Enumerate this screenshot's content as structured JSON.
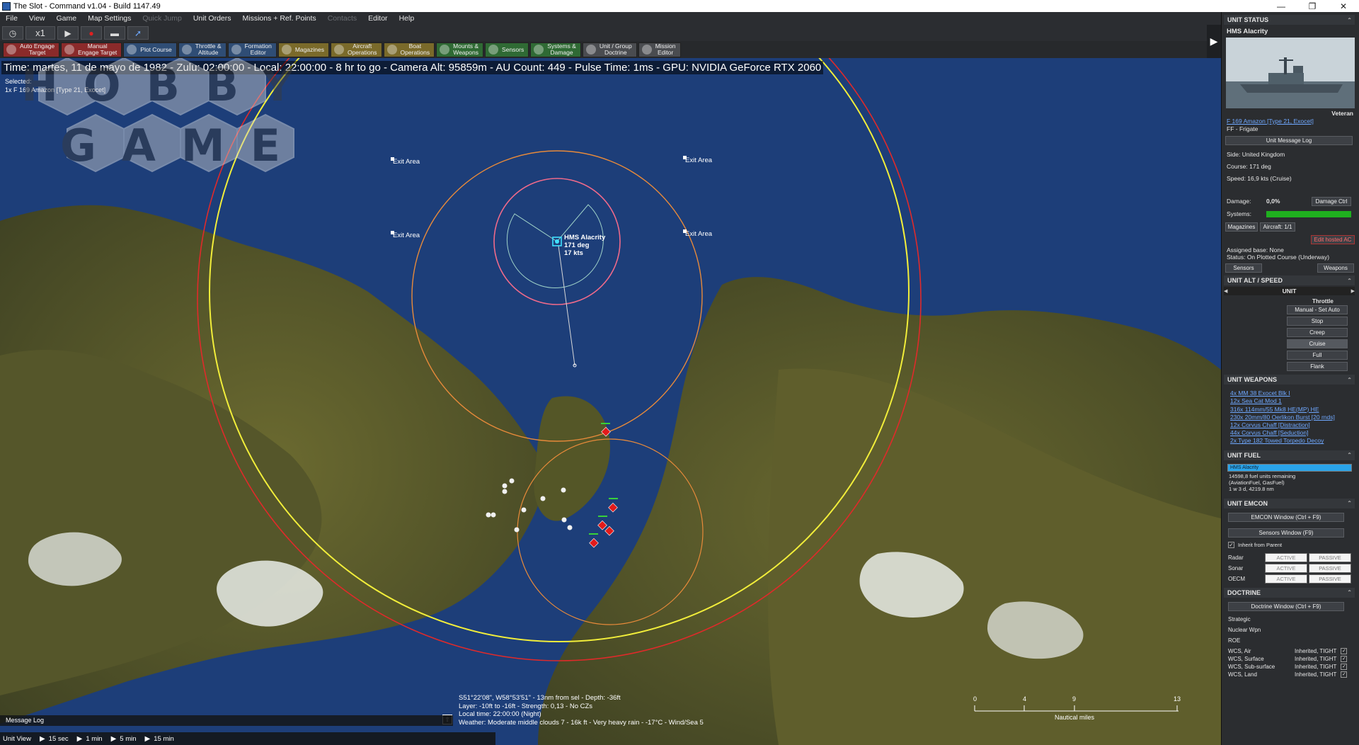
{
  "window": {
    "title": "The Slot - Command v1.04 - Build 1147.49",
    "controls": [
      "—",
      "❐",
      "✕"
    ]
  },
  "menu": [
    "File",
    "View",
    "Game",
    "Map Settings",
    "Quick Jump",
    "Unit Orders",
    "Missions + Ref. Points",
    "Contacts",
    "Editor",
    "Help"
  ],
  "menu_dim": [
    "Quick Jump",
    "Contacts"
  ],
  "playback": {
    "compression": "x1"
  },
  "commands": [
    {
      "l1": "Auto Engage",
      "l2": "Target",
      "color": "red"
    },
    {
      "l1": "Manual",
      "l2": "Engage Target",
      "color": "red"
    },
    {
      "l1": "Plot Course",
      "l2": "",
      "color": "blue"
    },
    {
      "l1": "Throttle &",
      "l2": "Altitude",
      "color": "blue"
    },
    {
      "l1": "Formation",
      "l2": "Editor",
      "color": "blue"
    },
    {
      "l1": "Magazines",
      "l2": "",
      "color": "gold"
    },
    {
      "l1": "Aircraft",
      "l2": "Operations",
      "color": "gold"
    },
    {
      "l1": "Boat",
      "l2": "Operations",
      "color": "gold"
    },
    {
      "l1": "Mounts &",
      "l2": "Weapons",
      "color": "green"
    },
    {
      "l1": "Sensors",
      "l2": "",
      "color": "green"
    },
    {
      "l1": "Systems &",
      "l2": "Damage",
      "color": "green"
    },
    {
      "l1": "Unit / Group",
      "l2": "Doctrine",
      "color": "grey"
    },
    {
      "l1": "Mission",
      "l2": "Editor",
      "color": "grey"
    }
  ],
  "map": {
    "status": "Time: martes, 11 de mayo de 1982 - Zulu: 02:00:00 - Local: 22:00:00 - 8 hr to go -  Camera Alt: 95859m  - AU Count: 449 - Pulse Time: 1ms - GPU: NVIDIA GeForce RTX 2060",
    "selected_label": "Selected:",
    "selected_unit": "1x F 169 Amazon [Type 21, Exocet]",
    "exit_area": "Exit Area",
    "unit_name": "HMS Alacrity",
    "unit_course": "171 deg",
    "unit_speed": "17 kts",
    "coords": [
      "S51°22'08\", W58°53'51\" - 13nm from sel - Depth: -36ft",
      "Layer: -10ft to -16ft - Strength: 0,13 - No CZs",
      "Local time: 22:00:00 (Night)",
      "Weather: Moderate middle clouds 7 - 16k ft - Very heavy rain - -17°C - Wind/Sea 5"
    ],
    "message_log": "Message Log",
    "unit_view": "Unit View",
    "time_steps": [
      "15 sec",
      "1 min",
      "5 min",
      "15 min"
    ],
    "scale_ticks": [
      "0",
      "4",
      "9",
      "13"
    ],
    "scale_unit": "Nautical miles",
    "watermark_top": "HOBBY",
    "watermark_bottom": "GAMES",
    "colors": {
      "sea": "#1d3e79",
      "land": "#5a5a2a",
      "red_ring": "#e02a2a",
      "yellow_ring": "#f2ee3a",
      "orange_ring": "#e88a3a",
      "pink_ring": "#f06a8a"
    }
  },
  "panel": {
    "unit_status": "UNIT STATUS",
    "unit_name": "HMS Alacrity",
    "proficiency": "Veteran",
    "class_link": "F 169 Amazon [Type 21, Exocet]",
    "type": "FF - Frigate",
    "message_log_btn": "Unit Message Log",
    "side": "Side: United Kingdom",
    "course": "Course: 171 deg",
    "speed": "Speed: 16,9 kts (Cruise)",
    "damage_label": "Damage:",
    "damage_value": "0,0%",
    "damage_btn": "Damage Ctrl",
    "systems_label": "Systems:",
    "magazines_btn": "Magazines",
    "aircraft_btn": "Aircraft: 1/1",
    "edit_hosted": "Edit hosted AC",
    "assigned_base": "Assigned base: None",
    "status": "Status: On Plotted Course (Underway)",
    "sensors_btn": "Sensors",
    "weapons_btn": "Weapons",
    "alt_speed": "UNIT ALT / SPEED",
    "unit_lbl": "UNIT",
    "throttle": "Throttle",
    "throttle_btns": [
      "Manual - Set Auto",
      "Stop",
      "Creep",
      "Cruise",
      "Full",
      "Flank"
    ],
    "weapons_hdr": "UNIT WEAPONS",
    "weapons": [
      "4x MM 38 Exocet Blk I",
      "12x Sea Cat Mod 1",
      "316x 114mm/55 Mk8 HE(MP) HE",
      "230x 20mm/80 Oerlikon Burst [20 rnds]",
      "12x Corvus Chaff [Distraction]",
      "44x Corvus Chaff [Seduction]",
      "2x Type 182 Towed Torpedo Decoy"
    ],
    "fuel_hdr": "UNIT FUEL",
    "fuel_bar": "HMS Alacrity",
    "fuel_fraction": 1.0,
    "fuel_text": [
      "14598,8 fuel units remaining",
      "(AviationFuel, GasFuel)",
      "1 w 3 d, 4219.8 nm"
    ],
    "emcon_hdr": "UNIT EMCON",
    "emcon_btn": "EMCON Window (Ctrl + F9)",
    "sensors_window": "Sensors Window (F9)",
    "inherit": "Inherit from Parent",
    "emcon_rows": [
      "Radar",
      "Sonar",
      "OECM"
    ],
    "active": "ACTIVE",
    "passive": "PASSIVE",
    "doctrine_hdr": "DOCTRINE",
    "doctrine_btn": "Doctrine Window (Ctrl + F9)",
    "doctrine_rows": [
      "Strategic",
      "Nuclear Wpn",
      "ROE"
    ],
    "wcs_rows": [
      {
        "label": "WCS, Air",
        "value": "Inherited, TIGHT"
      },
      {
        "label": "WCS, Surface",
        "value": "Inherited, TIGHT"
      },
      {
        "label": "WCS, Sub-surface",
        "value": "Inherited, TIGHT"
      },
      {
        "label": "WCS, Land",
        "value": "Inherited, TIGHT"
      }
    ],
    "systems_color": "#1fb01f",
    "fuel_color": "#2aa3e8"
  }
}
